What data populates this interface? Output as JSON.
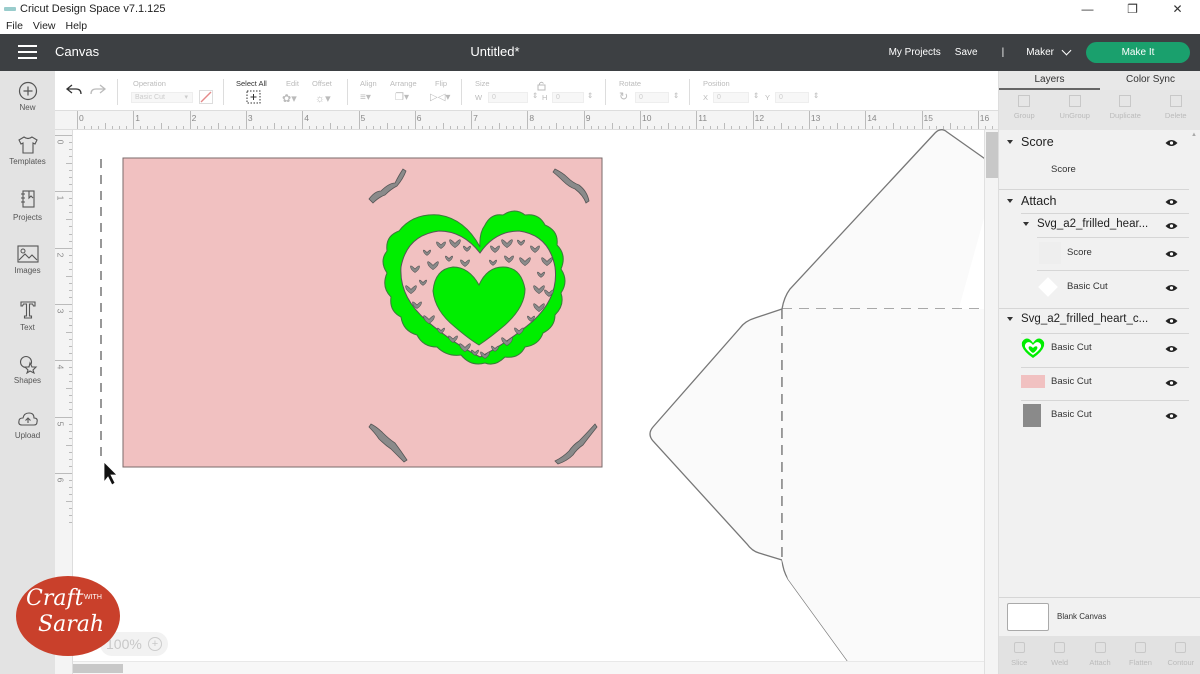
{
  "window": {
    "title": "Cricut Design Space  v7.1.125",
    "controls": [
      "minimize",
      "restore",
      "close"
    ],
    "menu": [
      "File",
      "View",
      "Help"
    ]
  },
  "appbar": {
    "section": "Canvas",
    "document_title": "Untitled*",
    "my_projects": "My Projects",
    "save": "Save",
    "separator": "|",
    "machine": "Maker",
    "make_it": "Make It",
    "make_it_color": "#1aa06d"
  },
  "leftbar": {
    "items": [
      {
        "label": "New",
        "icon": "plus-circle-icon"
      },
      {
        "label": "Templates",
        "icon": "tshirt-icon"
      },
      {
        "label": "Projects",
        "icon": "notebook-icon"
      },
      {
        "label": "Images",
        "icon": "image-icon"
      },
      {
        "label": "Text",
        "icon": "text-t-icon"
      },
      {
        "label": "Shapes",
        "icon": "shapes-icon"
      },
      {
        "label": "Upload",
        "icon": "cloud-upload-icon"
      }
    ]
  },
  "toolbar": {
    "operation_label": "Operation",
    "operation_value": "Basic Cut",
    "select_all": "Select All",
    "edit": "Edit",
    "offset": "Offset",
    "align": "Align",
    "arrange": "Arrange",
    "flip": "Flip",
    "size": "Size",
    "w_label": "W",
    "w_value": "0",
    "h_label": "H",
    "h_value": "0",
    "rotate": "Rotate",
    "rotate_value": "0",
    "position": "Position",
    "x_label": "X",
    "x_value": "0",
    "y_label": "Y",
    "y_value": "0"
  },
  "rulers": {
    "top": [
      "0",
      "1",
      "2",
      "3",
      "4",
      "5",
      "6",
      "7",
      "8",
      "9",
      "10",
      "11",
      "12",
      "13",
      "14",
      "15",
      "16"
    ],
    "left": [
      "0",
      "1",
      "2",
      "3",
      "4",
      "5",
      "6"
    ]
  },
  "zoom": {
    "value": "100%"
  },
  "canvas": {
    "card_color": "#f1c1c1",
    "frill_color": "#00ee00",
    "cut_color": "#8a8a8a"
  },
  "rightpanel": {
    "tabs": [
      "Layers",
      "Color Sync"
    ],
    "actions": [
      "Group",
      "UnGroup",
      "Duplicate",
      "Delete"
    ],
    "layers": [
      {
        "name": "Score",
        "children": [
          {
            "name": "Score"
          }
        ]
      },
      {
        "name": "Attach",
        "children": [
          {
            "name": "Svg_a2_frilled_hear...",
            "children": [
              {
                "name": "Score"
              },
              {
                "name": "Basic Cut"
              }
            ]
          }
        ]
      },
      {
        "name": "Svg_a2_frilled_heart_c...",
        "children": [
          {
            "name": "Basic Cut"
          },
          {
            "name": "Basic Cut"
          },
          {
            "name": "Basic Cut"
          }
        ]
      }
    ],
    "blank_canvas": "Blank Canvas",
    "bottom_actions": [
      "Slice",
      "Weld",
      "Attach",
      "Flatten",
      "Contour"
    ]
  },
  "watermark": {
    "line1": "Craft",
    "with": "WITH",
    "line2": "Sarah"
  }
}
